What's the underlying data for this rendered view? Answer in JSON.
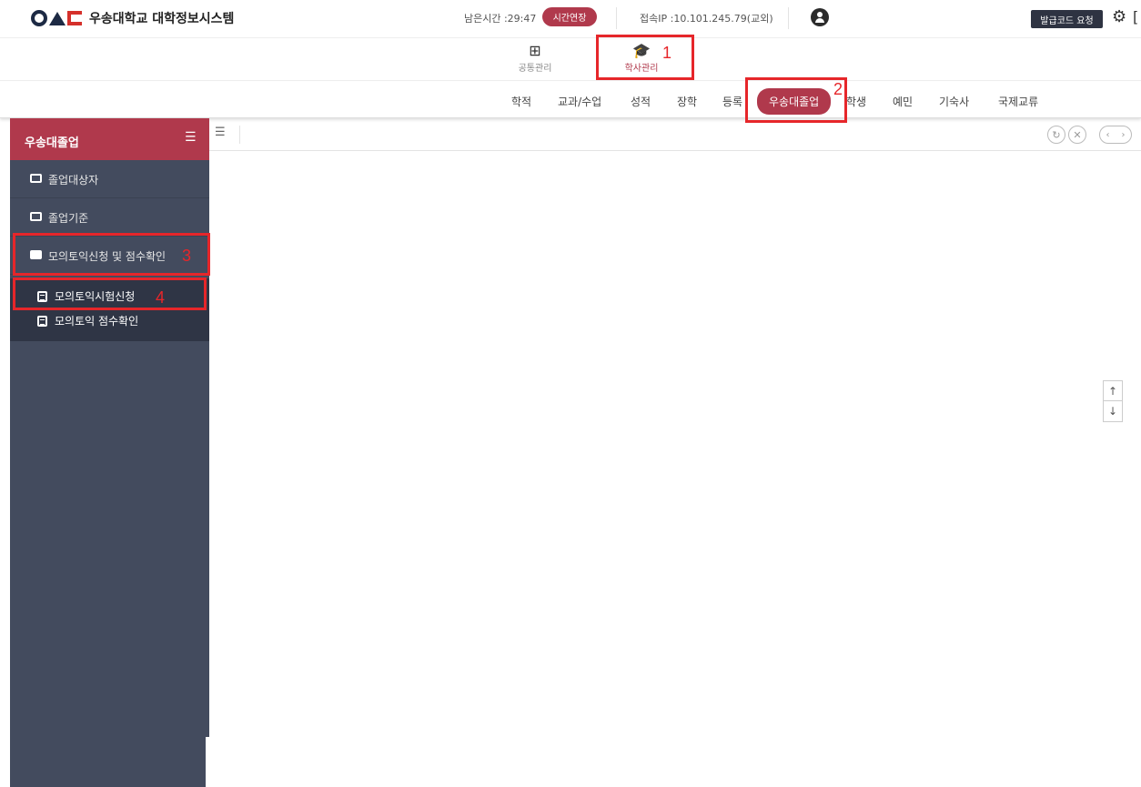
{
  "header": {
    "logo_text": "우송대학교 대학정보시스템",
    "timer": "남은시간 :29:47",
    "extend_button": "시간연장",
    "ip": "접속IP :10.101.245.79(교외)",
    "issue_button": "발급코드 요청"
  },
  "modules": [
    {
      "label": "공통관리",
      "icon": "grid-icon"
    },
    {
      "label": "학사관리",
      "icon": "graduation-cap-icon"
    }
  ],
  "menu": [
    "학적",
    "교과/수업",
    "성적",
    "장학",
    "등록",
    "우송대졸업",
    "학생",
    "예민",
    "기숙사",
    "국제교류"
  ],
  "menu_active": "우송대졸업",
  "sidebar": {
    "title": "우송대졸업",
    "items": [
      {
        "label": "졸업대상자"
      },
      {
        "label": "졸업기준"
      },
      {
        "label": "모의토익신청 및 점수확인"
      }
    ],
    "subitems": [
      {
        "label": "모의토익시험신청"
      },
      {
        "label": "모의토익 점수확인"
      }
    ]
  },
  "annotations": [
    "1",
    "2",
    "3",
    "4"
  ],
  "colors": {
    "accent": "#b0394c",
    "sidebar": "#434b5e",
    "highlight": "#e6262a"
  }
}
